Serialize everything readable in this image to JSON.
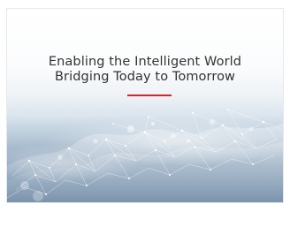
{
  "hero": {
    "headline_line1": "Enabling the Intelligent World",
    "headline_line2": "Bridging Today to Tomorrow"
  },
  "colors": {
    "accent_rule": "#cf2a2a",
    "headline_text": "#333333",
    "network_glow": "#ffffff",
    "background_blue": "#7a93ac"
  }
}
